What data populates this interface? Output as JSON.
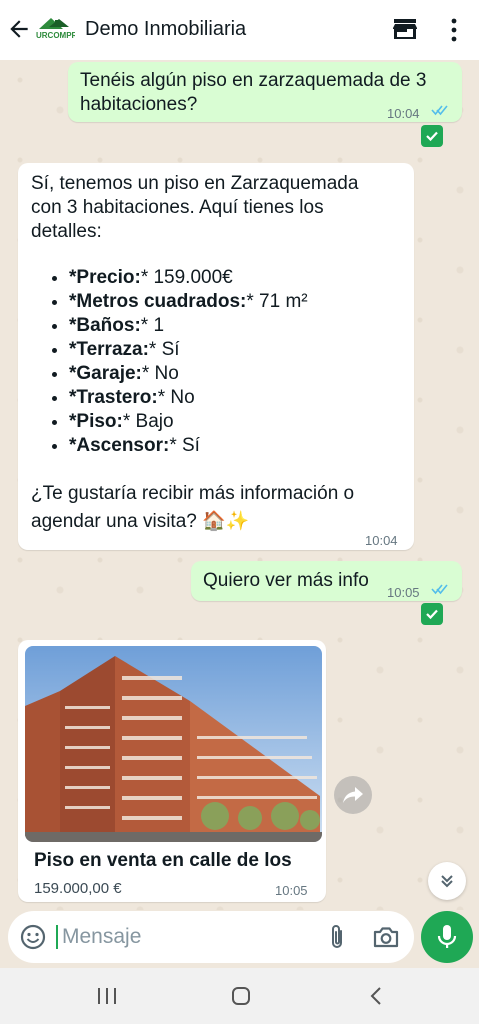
{
  "header": {
    "contact_name": "Demo Inmobiliaria",
    "logo_text": "URCOMPR"
  },
  "messages": [
    {
      "direction": "outgoing",
      "text_line1": "Tenéis algún piso en zarzaquemada de 3",
      "text_line2": "habitaciones?",
      "time": "10:04",
      "status": "read"
    },
    {
      "direction": "incoming",
      "intro_lines": [
        "Sí, tenemos un piso en Zarzaquemada",
        "con 3 habitaciones. Aquí tienes los",
        "detalles:"
      ],
      "details": [
        {
          "label": "*Precio:",
          "value": "* 159.000€"
        },
        {
          "label": "*Metros cuadrados:",
          "value": "* 71 m²"
        },
        {
          "label": "*Baños:",
          "value": "* 1"
        },
        {
          "label": "*Terraza:",
          "value": "* Sí"
        },
        {
          "label": "*Garaje:",
          "value": "* No"
        },
        {
          "label": "*Trastero:",
          "value": "* No"
        },
        {
          "label": "*Piso:",
          "value": "* Bajo"
        },
        {
          "label": "*Ascensor:",
          "value": "* Sí"
        }
      ],
      "outro_line1": "¿Te gustaría recibir más información o",
      "outro_line2": "agendar una visita? 🏠✨",
      "time": "10:04"
    },
    {
      "direction": "outgoing",
      "text": "Quiero ver más info",
      "time": "10:05",
      "status": "read"
    },
    {
      "direction": "incoming",
      "type": "listing",
      "title": "Piso en venta en calle de los",
      "price": "159.000,00 €",
      "time": "10:05"
    }
  ],
  "composer": {
    "placeholder": "Mensaje"
  },
  "colors": {
    "accent": "#1fa855",
    "outgoing_bubble": "#d9fdd3",
    "incoming_bubble": "#ffffff",
    "chat_background": "#efe7dc",
    "read_ticks": "#53bdeb"
  },
  "icons": [
    "back-arrow-icon",
    "store-icon",
    "more-vertical-icon",
    "check-icon",
    "forward-icon",
    "double-chevron-down-icon",
    "emoji-icon",
    "attach-icon",
    "camera-icon",
    "mic-icon",
    "nav-recents-icon",
    "nav-home-icon",
    "nav-back-icon"
  ]
}
